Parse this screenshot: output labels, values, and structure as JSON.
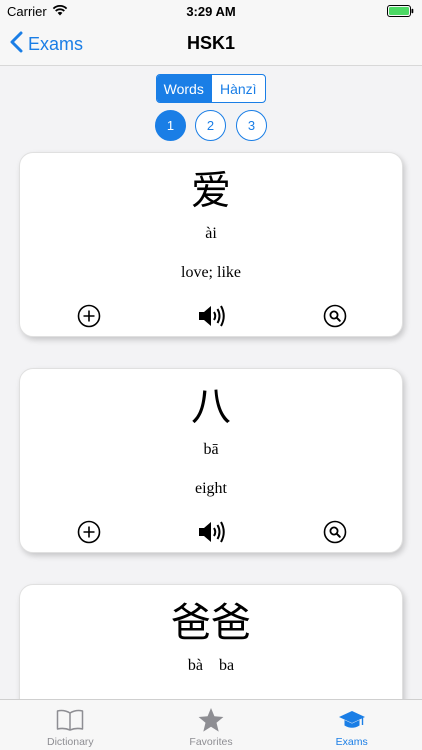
{
  "status_bar": {
    "carrier": "Carrier",
    "time": "3:29 AM"
  },
  "nav": {
    "back_label": "Exams",
    "title": "HSK1"
  },
  "segments": [
    {
      "label": "Words",
      "selected": true
    },
    {
      "label": "Hànzì",
      "selected": false
    }
  ],
  "pages": [
    {
      "label": "1",
      "selected": true
    },
    {
      "label": "2",
      "selected": false
    },
    {
      "label": "3",
      "selected": false
    }
  ],
  "cards": [
    {
      "hanzi": "爱",
      "pinyin": "ài",
      "meaning": "love; like"
    },
    {
      "hanzi": "八",
      "pinyin": "bā",
      "meaning": "eight"
    },
    {
      "hanzi": "爸爸",
      "pinyin": "bà    ba",
      "meaning": ""
    }
  ],
  "card_actions": {
    "add_icon": "plus-circle-icon",
    "speak_icon": "speaker-icon",
    "search_icon": "magnifier-circle-icon"
  },
  "tabs": [
    {
      "label": "Dictionary",
      "icon": "book-icon",
      "selected": false
    },
    {
      "label": "Favorites",
      "icon": "star-icon",
      "selected": false
    },
    {
      "label": "Exams",
      "icon": "graduation-cap-icon",
      "selected": true
    }
  ],
  "colors": {
    "accent": "#1a7ee6",
    "inactive": "#8e8e93",
    "battery": "#4cd964"
  }
}
